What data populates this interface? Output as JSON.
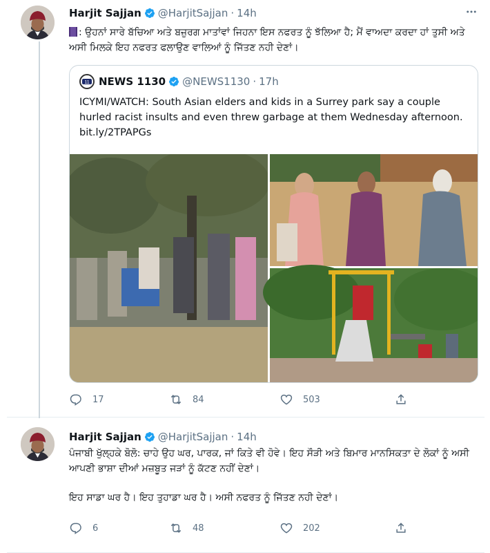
{
  "tweets": [
    {
      "author_name": "Harjit Sajjan",
      "handle": "@HarjitSajjan",
      "separator": "·",
      "time": "14h",
      "text": ": ਉਹਨਾਂ ਸਾਰੇ ਬੱਚਿਆ ਅਤੇ ਬਜ਼ੁਰਗ ਮਾਤਾਂਵਾਂ ਜਿਹਨਾ ਇਸ ਨਫਰਤ ਨੂੰ ਝੱਲਿਆ ਹੈ; ਮੈਂ ਵਾਅਦਾ ਕਰਦਾ ਹਾਂ ਤੁਸੀ ਅਤੇ ਅਸੀ ਮਿਲਕੇ ਇਹ ਨਫਰਤ ਫਲਾਉਣ ਵਾਲਿਆਂ ਨੂੰ ਜਿੱਤਣ ਨਹੀ ਦੇਣਾਂ।",
      "quoted": {
        "author_name": "NEWS 1130",
        "handle": "@NEWS1130",
        "separator": "·",
        "time": "17h",
        "text": "ICYMI/WATCH: South Asian elders and kids in a Surrey park say a couple hurled racist insults and even threw garbage at them Wednesday afternoon. bit.ly/2TPAPGs"
      },
      "replies": "17",
      "retweets": "84",
      "likes": "503"
    },
    {
      "author_name": "Harjit Sajjan",
      "handle": "@HarjitSajjan",
      "separator": "·",
      "time": "14h",
      "text": "ਪੰਜਾਬੀ ਖੁੱਲ੍ਹਕੇ ਬੋਲੋ: ਚਾਹੇ ਉਹ ਘਰ, ਪਾਰਕ, ਜਾਂ ਕਿਤੇ ਵੀ ਹੋਵੇ। ਇਹ ਸੌੜੀ ਅਤੇ  ਬਿਮਾਰ ਮਾਨਸਿਕਤਾ ਦੇ ਲੋਕਾਂ ਨੂੰ ਅਸੀ ਆਪਣੀ ਭਾਸ਼ਾ ਦੀਆਂ ਮਜ਼ਬੂਤ ਜੜਾਂ ਨੂੰ ਕੱਟਣ ਨਹੀਂ ਦੇਣਾਂ।",
      "text2": "ਇਹ ਸਾਡਾ ਘਰ ਹੈ। ਇਹ ਤੁਹਾਡਾ ਘਰ ਹੈ। ਅਸੀ ਨਫਰਤ ਨੂੰ ਜਿੱਤਣ ਨਹੀ ਦੇਣਾਂ।",
      "replies": "6",
      "retweets": "48",
      "likes": "202"
    }
  ],
  "icons": {
    "verified": "verified-badge-icon",
    "reply": "reply-icon",
    "retweet": "retweet-icon",
    "like": "heart-icon",
    "share": "share-icon",
    "more": "more-icon",
    "emoji": "purple-square-emoji"
  },
  "colors": {
    "verified_blue": "#1da1f2",
    "secondary_text": "#5b7083",
    "border": "#ccd6dd"
  }
}
